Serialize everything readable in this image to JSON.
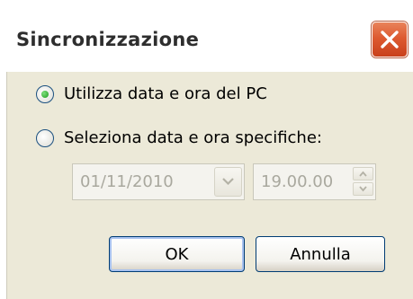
{
  "dialog": {
    "title": "Sincronizzazione",
    "options": [
      {
        "label": "Utilizza data e ora del PC",
        "selected": true
      },
      {
        "label": "Seleziona data e ora specifiche:",
        "selected": false
      }
    ],
    "date_field": {
      "value": "01/11/2010",
      "enabled": false
    },
    "time_field": {
      "value": "19.00.00",
      "enabled": false
    },
    "ok_label": "OK",
    "cancel_label": "Annulla"
  },
  "icons": {
    "close": "close-icon",
    "dropdown": "chevron-down-icon",
    "spin_up": "chevron-up-icon",
    "spin_down": "chevron-down-icon"
  },
  "colors": {
    "close_button": "#dd5a31",
    "dialog_background": "#ece9d8",
    "radio_selected": "#1d9b1d",
    "disabled_text": "#a9a89e"
  }
}
